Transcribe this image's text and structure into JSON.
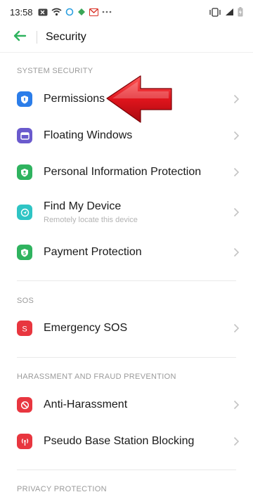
{
  "status_bar": {
    "time": "13:58",
    "icons": [
      "screen-record-icon",
      "wifi-icon",
      "vpn-icon",
      "app-notification-icon",
      "gmail-icon",
      "more-dots-icon"
    ],
    "right_icons": [
      "vibrate-icon",
      "signal-icon",
      "battery-charging-icon"
    ]
  },
  "header": {
    "back_icon": "arrow-left-icon",
    "title": "Security"
  },
  "sections": [
    {
      "header": "SYSTEM SECURITY",
      "items": [
        {
          "label": "Permissions",
          "icon": "shield-icon",
          "color": "#2b7de9"
        },
        {
          "label": "Floating Windows",
          "icon": "window-icon",
          "color": "#6a5acd"
        },
        {
          "label": "Personal Information Protection",
          "icon": "person-shield-icon",
          "color": "#2fb35f"
        },
        {
          "label": "Find My Device",
          "sublabel": "Remotely locate this device",
          "icon": "locate-icon",
          "color": "#2ec4c4"
        },
        {
          "label": "Payment Protection",
          "icon": "payment-shield-icon",
          "color": "#2fb35f"
        }
      ]
    },
    {
      "header": "SOS",
      "items": [
        {
          "label": "Emergency SOS",
          "icon": "sos-icon",
          "color": "#e8363f"
        }
      ]
    },
    {
      "header": "HARASSMENT AND FRAUD PREVENTION",
      "items": [
        {
          "label": "Anti-Harassment",
          "icon": "block-icon",
          "color": "#e8363f"
        },
        {
          "label": "Pseudo Base Station Blocking",
          "icon": "antenna-icon",
          "color": "#e8363f"
        }
      ]
    },
    {
      "header": "PRIVACY PROTECTION",
      "items": []
    }
  ],
  "colors": {
    "accent": "#2fb35f",
    "annotation_arrow": "#d9141e"
  }
}
